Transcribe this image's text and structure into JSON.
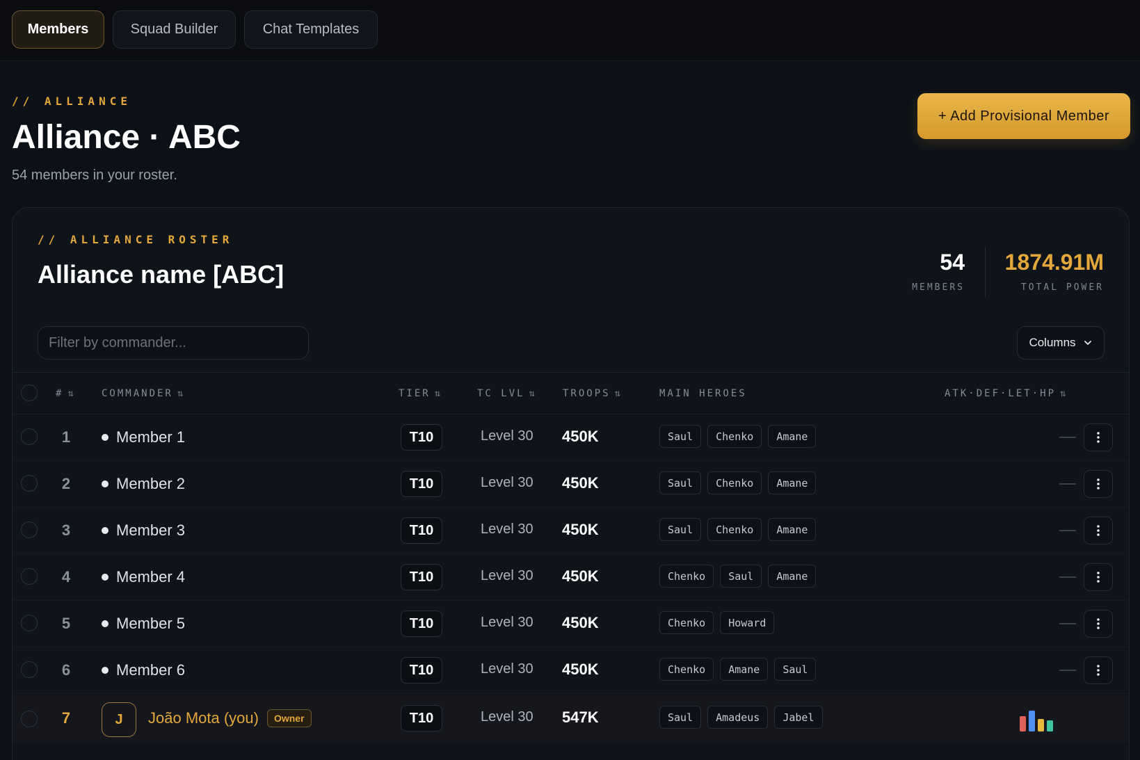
{
  "nav": {
    "tabs": [
      {
        "label": "Members"
      },
      {
        "label": "Squad Builder"
      },
      {
        "label": "Chat Templates"
      }
    ]
  },
  "header": {
    "eyebrow": "// ALLIANCE",
    "title": "Alliance · ABC",
    "subtitle": "54 members in your roster.",
    "add_button": "+ Add Provisional Member"
  },
  "roster": {
    "eyebrow": "// ALLIANCE ROSTER",
    "title": "Alliance name [ABC]",
    "stats": {
      "members_value": "54",
      "members_label": "MEMBERS",
      "power_value": "1874.91M",
      "power_label": "TOTAL POWER"
    },
    "filter_placeholder": "Filter by commander...",
    "columns_button": "Columns",
    "columns": {
      "num": "#",
      "commander": "COMMANDER",
      "tier": "TIER",
      "tc_lvl": "TC LVL",
      "troops": "TROOPS",
      "heroes": "MAIN HEROES",
      "stats": "ATK·DEF·LET·HP"
    },
    "rows": [
      {
        "num": "1",
        "name": "Member 1",
        "tier": "T10",
        "level": "Level 30",
        "troops": "450K",
        "heroes": [
          "Saul",
          "Chenko",
          "Amane"
        ]
      },
      {
        "num": "2",
        "name": "Member 2",
        "tier": "T10",
        "level": "Level 30",
        "troops": "450K",
        "heroes": [
          "Saul",
          "Chenko",
          "Amane"
        ]
      },
      {
        "num": "3",
        "name": "Member 3",
        "tier": "T10",
        "level": "Level 30",
        "troops": "450K",
        "heroes": [
          "Saul",
          "Chenko",
          "Amane"
        ]
      },
      {
        "num": "4",
        "name": "Member 4",
        "tier": "T10",
        "level": "Level 30",
        "troops": "450K",
        "heroes": [
          "Chenko",
          "Saul",
          "Amane"
        ]
      },
      {
        "num": "5",
        "name": "Member 5",
        "tier": "T10",
        "level": "Level 30",
        "troops": "450K",
        "heroes": [
          "Chenko",
          "Howard"
        ]
      },
      {
        "num": "6",
        "name": "Member 6",
        "tier": "T10",
        "level": "Level 30",
        "troops": "450K",
        "heroes": [
          "Chenko",
          "Amane",
          "Saul"
        ]
      }
    ],
    "you_row": {
      "num": "7",
      "avatar_initial": "J",
      "name": "João Mota (you)",
      "badge": "Owner",
      "tier": "T10",
      "level": "Level 30",
      "troops": "547K",
      "heroes": [
        "Saul",
        "Amadeus",
        "Jabel"
      ],
      "stat_colors": [
        "#e0625a",
        "#4f8ff0",
        "#e8b83c",
        "#3fc3a0"
      ]
    }
  },
  "colors": {
    "accent": "#e3a73b",
    "background": "#0c1118",
    "card": "#0f141b"
  }
}
